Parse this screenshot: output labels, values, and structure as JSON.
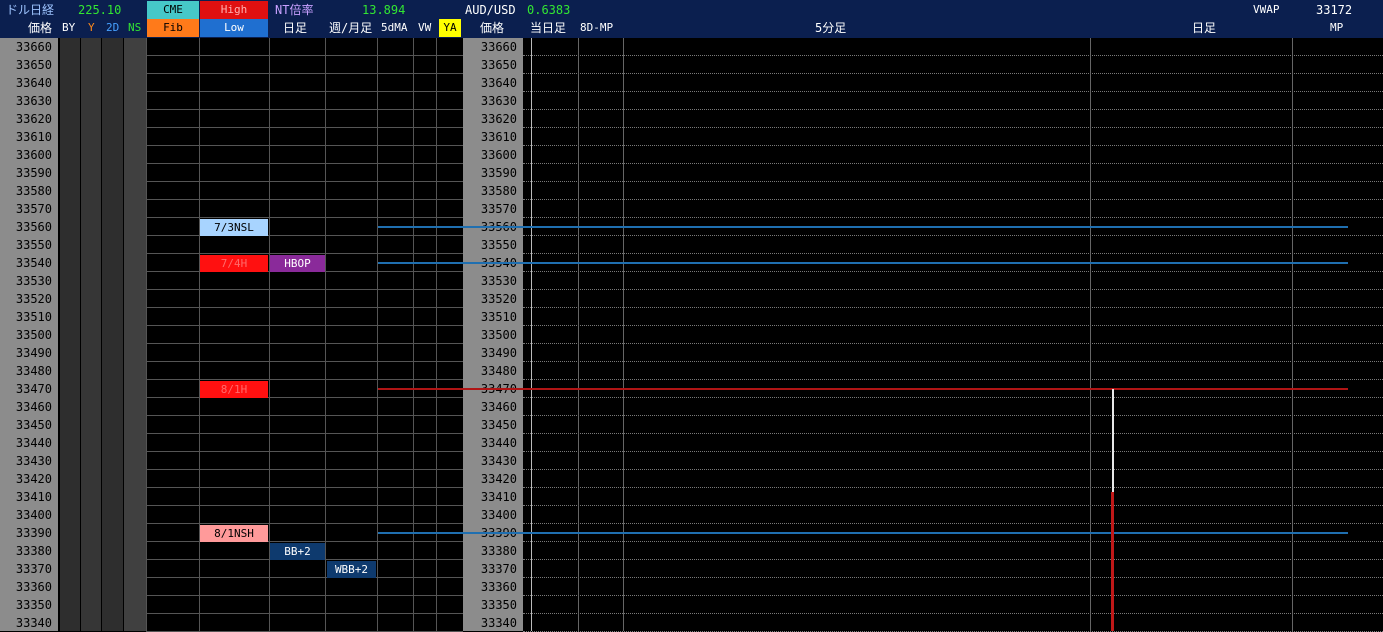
{
  "header": {
    "dollar_nikkei_label": "ドル日経",
    "dollar_nikkei_value": "225.10",
    "cme_label": "CME",
    "high_label": "High",
    "nt_label": "NT倍率",
    "nt_value": "13.894",
    "audusd_label": "AUD/USD",
    "audusd_value": "0.6383",
    "vwap_label": "VWAP",
    "vwap_value": "33172",
    "price_label": "価格",
    "by_label": "BY",
    "y_label": "Y",
    "twod_label": "2D",
    "ns_label": "NS",
    "fib_label": "Fib",
    "low_label": "Low",
    "daily_label": "日足",
    "weekmonth_label": "週/月足",
    "fivedma_label": "5dMA",
    "vw_label": "VW",
    "ya_label": "YA",
    "price_label2": "価格",
    "today_label": "当日足",
    "eightd_label": "8D-MP",
    "fivemin_label": "5分足",
    "daily_label2": "日足",
    "mp_label": "MP"
  },
  "prices": [
    "33660",
    "33650",
    "33640",
    "33630",
    "33620",
    "33610",
    "33600",
    "33590",
    "33580",
    "33570",
    "33560",
    "33550",
    "33540",
    "33530",
    "33520",
    "33510",
    "33500",
    "33490",
    "33480",
    "33470",
    "33460",
    "33450",
    "33440",
    "33430",
    "33420",
    "33410",
    "33400",
    "33390",
    "33380",
    "33370",
    "33360",
    "33350",
    "33340"
  ],
  "levels": [
    {
      "text": "7/3NSL",
      "price": "33560",
      "color": "#a8d4ff",
      "fg": "#000",
      "column": "high"
    },
    {
      "text": "7/4H",
      "price": "33540",
      "color": "#ff1010",
      "fg": "#ff6a6a",
      "column": "high"
    },
    {
      "text": "HBOP",
      "price": "33540",
      "color": "#8a2a9a",
      "fg": "#ffffff",
      "column": "daily"
    },
    {
      "text": "8/1H",
      "price": "33470",
      "color": "#ff1010",
      "fg": "#ff6a6a",
      "column": "high"
    },
    {
      "text": "8/1NSH",
      "price": "33390",
      "color": "#ff9a9a",
      "fg": "#000",
      "column": "high"
    },
    {
      "text": "BB+2",
      "price": "33380",
      "color": "#0e3a6e",
      "fg": "#ffffff",
      "column": "daily"
    },
    {
      "text": "WBB+2",
      "price": "33370",
      "color": "#0e3a6e",
      "fg": "#ffffff",
      "column": "weekly"
    }
  ],
  "lines": [
    {
      "price": "33560",
      "color": "#1f6fb0"
    },
    {
      "price": "33540",
      "color": "#1f6fb0"
    },
    {
      "price": "33470",
      "color": "#b01515"
    },
    {
      "price": "33390",
      "color": "#1f6fb0"
    }
  ],
  "colors": {
    "header_bg": "#0b1f4f",
    "price_col": "#8c8c8c",
    "grid": "#5a5a5a",
    "cme": "#46c8c8",
    "high": "#e01010",
    "fib": "#ff7a1a",
    "low": "#1f6fd0",
    "ya": "#ffff00"
  }
}
